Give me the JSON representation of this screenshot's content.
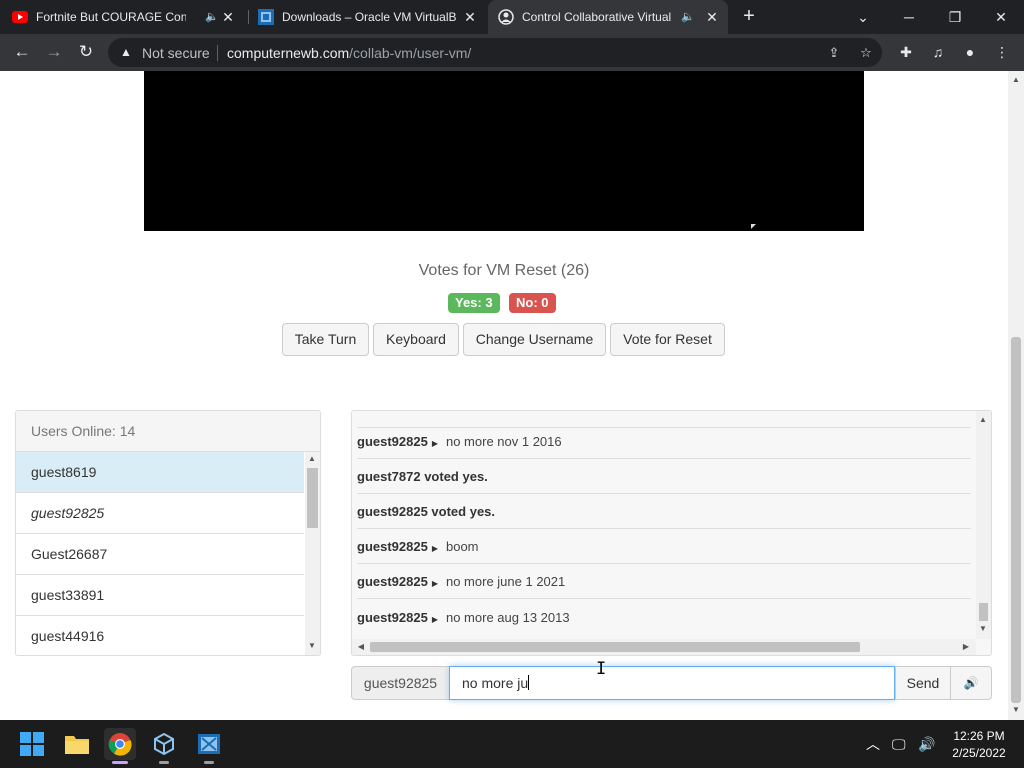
{
  "browser": {
    "tabs": [
      {
        "title": "Fortnite But COURAGE Contr",
        "favicon": "youtube-icon",
        "audio": true
      },
      {
        "title": "Downloads – Oracle VM VirtualB",
        "favicon": "virtualbox-icon"
      },
      {
        "title": "Control Collaborative Virtual",
        "favicon": "collabvm-icon",
        "audio": true,
        "active": true
      }
    ],
    "security_label": "Not secure",
    "url_host": "computernewb.com",
    "url_path": "/collab-vm/user-vm/"
  },
  "vote": {
    "title": "Votes for VM Reset (26)",
    "yes_label": "Yes: 3",
    "no_label": "No: 0"
  },
  "buttons": {
    "take_turn": "Take Turn",
    "keyboard": "Keyboard",
    "change_username": "Change Username",
    "vote_reset": "Vote for Reset"
  },
  "users": {
    "header": "Users Online: 14",
    "list": [
      {
        "name": "guest8619"
      },
      {
        "name": "guest92825"
      },
      {
        "name": "Guest26687"
      },
      {
        "name": "guest33891"
      },
      {
        "name": "guest44916"
      }
    ]
  },
  "chat": {
    "messages": [
      {
        "user": "guest92825",
        "text": "no more nov 1 2016"
      },
      {
        "system": "guest7872 voted yes."
      },
      {
        "system": "guest92825 voted yes."
      },
      {
        "user": "guest92825",
        "text": "boom"
      },
      {
        "user": "guest92825",
        "text": "no more june 1 2021"
      },
      {
        "user": "guest92825",
        "text": "no more aug 13 2013"
      }
    ],
    "username": "guest92825",
    "input_value": "no more ju",
    "send_label": "Send"
  },
  "taskbar": {
    "time": "12:26 PM",
    "date": "2/25/2022"
  },
  "colors": {
    "yes": "#5cb85c",
    "no": "#d9534f",
    "active_user": "#d9edf7",
    "taskbar": "#1c1c1c",
    "chrome_dark": "#202124"
  }
}
